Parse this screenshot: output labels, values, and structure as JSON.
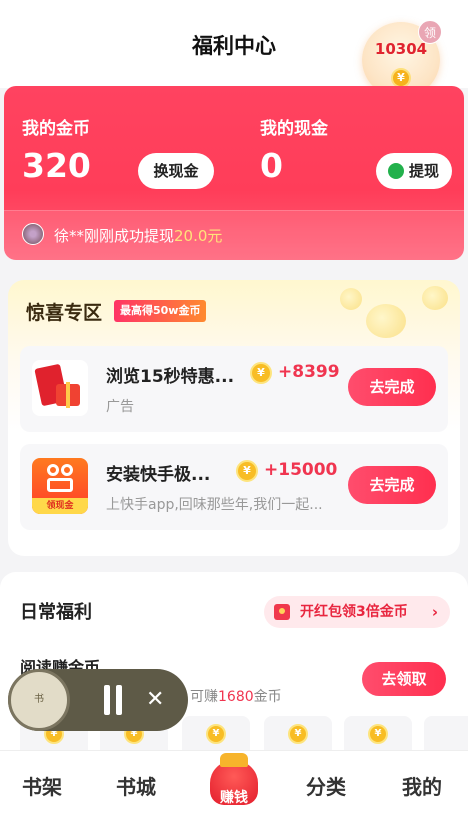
{
  "header": {
    "title": "福利中心",
    "coin_count": "10304",
    "claim_badge": "领"
  },
  "wallet": {
    "coins_label": "我的金币",
    "coins_value": "320",
    "exchange_button": "换现金",
    "cash_label": "我的现金",
    "cash_value": "0",
    "withdraw_button": "提现",
    "ticker_text": "徐**刚刚成功提现",
    "ticker_amount": "20.0元"
  },
  "surprise": {
    "title": "惊喜专区",
    "tag": "最高得50w金币",
    "tasks": [
      {
        "title": "浏览15秒特惠...",
        "reward": "+8399",
        "subtitle": "广告",
        "button": "去完成",
        "icon": "red-envelope-gift-icon"
      },
      {
        "title": "安装快手极...",
        "reward": "+15000",
        "subtitle": "上快手app,回味那些年,我们一起...",
        "button": "去完成",
        "icon": "kuaishou-icon",
        "icon_caption": "领现金"
      }
    ]
  },
  "daily": {
    "title": "日常福利",
    "pill": "开红包领3倍金币",
    "read_title": "阅读赚金币",
    "read_sub_prefix": "可赚",
    "read_sub_amount": "1680",
    "read_sub_suffix": "金币",
    "claim_button": "去领取"
  },
  "player": {
    "cover_text": "书"
  },
  "tabbar": {
    "bookshelf": "书架",
    "bookstore": "书城",
    "earn": "赚钱",
    "category": "分类",
    "mine": "我的"
  },
  "colors": {
    "brand_red": "#ff3d59",
    "coin_gold": "#f8bd25"
  }
}
